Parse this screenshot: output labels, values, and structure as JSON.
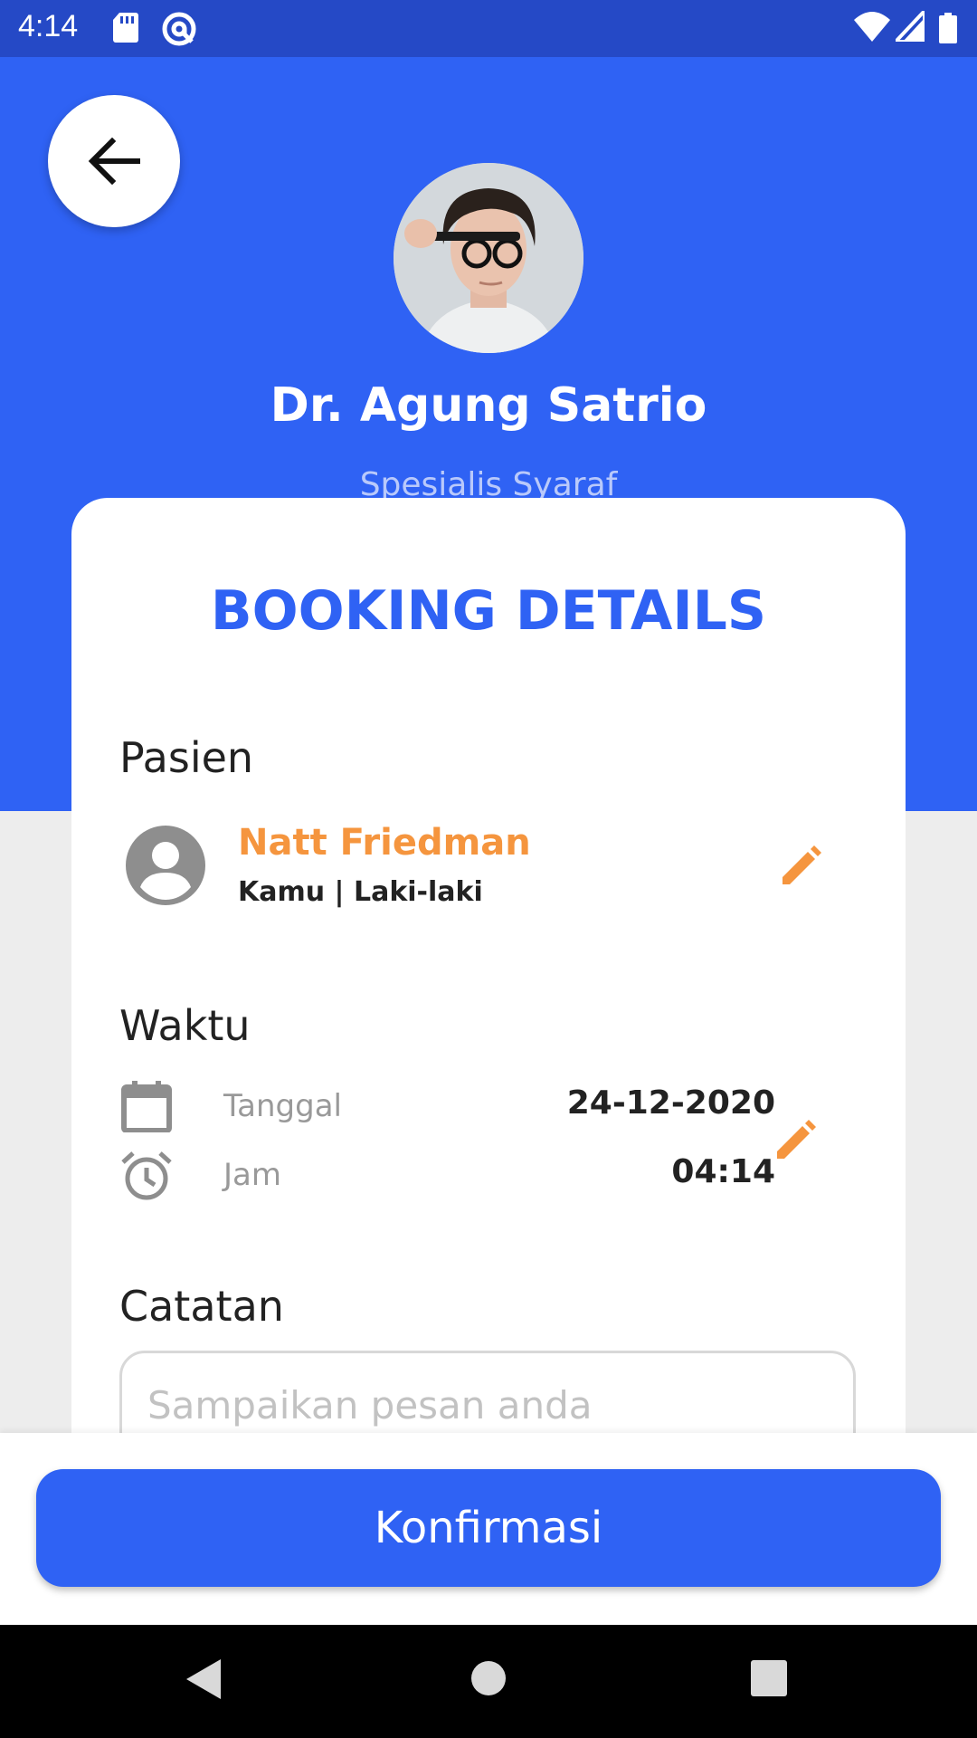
{
  "status_bar": {
    "time": "4:14"
  },
  "header": {
    "doctor_name": "Dr. Agung Satrio",
    "doctor_specialty": "Spesialis Syaraf"
  },
  "card": {
    "title": "BOOKING DETAILS",
    "patient_section": {
      "label": "Pasien",
      "name": "Natt Friedman",
      "meta": "Kamu | Laki-laki"
    },
    "time_section": {
      "label": "Waktu",
      "date_label": "Tanggal",
      "date_value": "24-12-2020",
      "time_label": "Jam",
      "time_value": "04:14"
    },
    "notes_section": {
      "label": "Catatan",
      "placeholder": "Sampaikan pesan anda"
    }
  },
  "footer": {
    "confirm_label": "Konfirmasi"
  },
  "colors": {
    "primary": "#2f62f4",
    "accent": "#f5953e",
    "status_bar": "#2549c6"
  }
}
